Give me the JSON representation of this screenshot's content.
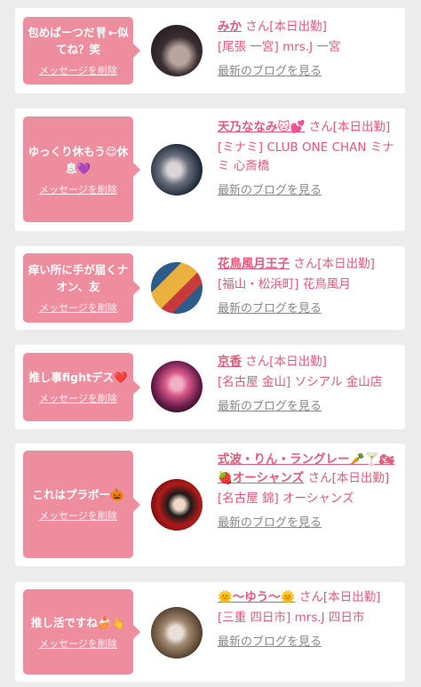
{
  "entries": [
    {
      "message": "包めばーつだ🦷←似てね？笑",
      "delete_label": "メッセージを削除",
      "name": "みか",
      "suffix": "さん[本日出勤]",
      "shop": "[尾張 一宮] mrs.J 一宮",
      "blog_label": "最新のブログを見る",
      "avatar_colors": [
        "#2a2226",
        "#b9a4a0"
      ]
    },
    {
      "message": "ゆっくり休もう😌休息💜",
      "delete_label": "メッセージを削除",
      "name": "天乃ななみ🐱💕",
      "suffix": "さん[本日出勤]",
      "shop": "[ミナミ] CLUB ONE CHAN ミナミ 心斎橋",
      "blog_label": "最新のブログを見る",
      "avatar_colors": [
        "#1e2a3a",
        "#c8c4c6"
      ]
    },
    {
      "message": "痒い所に手が届くナオン、友",
      "delete_label": "メッセージを削除",
      "name": "花鳥風月王子",
      "suffix": "さん[本日出勤]",
      "shop": "[福山・松浜町] 花鳥風月",
      "blog_label": "最新のブログを見る",
      "avatar_colors": [
        "#e9b23c",
        "#2e5c8a"
      ]
    },
    {
      "message": "推し事fightデス❤️",
      "delete_label": "メッセージを削除",
      "name": "京香",
      "suffix": "さん[本日出勤]",
      "shop": "[名古屋 金山] ソシアル 金山店",
      "blog_label": "最新のブログを見る",
      "avatar_colors": [
        "#6a1c4a",
        "#d85a8a"
      ]
    },
    {
      "message": "これはプラボー🎃",
      "delete_label": "メッセージを削除",
      "name": "式波・りん・ラングレー🥕🍸🏍🍓オーシャンズ",
      "suffix": "さん[本日出勤]",
      "shop": "[名古屋 錦] オーシャンズ",
      "blog_label": "最新のブログを見る",
      "avatar_colors": [
        "#b21a1a",
        "#1a1a1a"
      ]
    },
    {
      "message": "推し活ですね🍰👆",
      "delete_label": "メッセージを削除",
      "name": "🌞〜ゆう〜🌞",
      "suffix": "さん[本日出勤]",
      "shop": "[三重 四日市] mrs.J 四日市",
      "blog_label": "最新のブログを見る",
      "avatar_colors": [
        "#6b5440",
        "#e8e0d6"
      ]
    }
  ]
}
